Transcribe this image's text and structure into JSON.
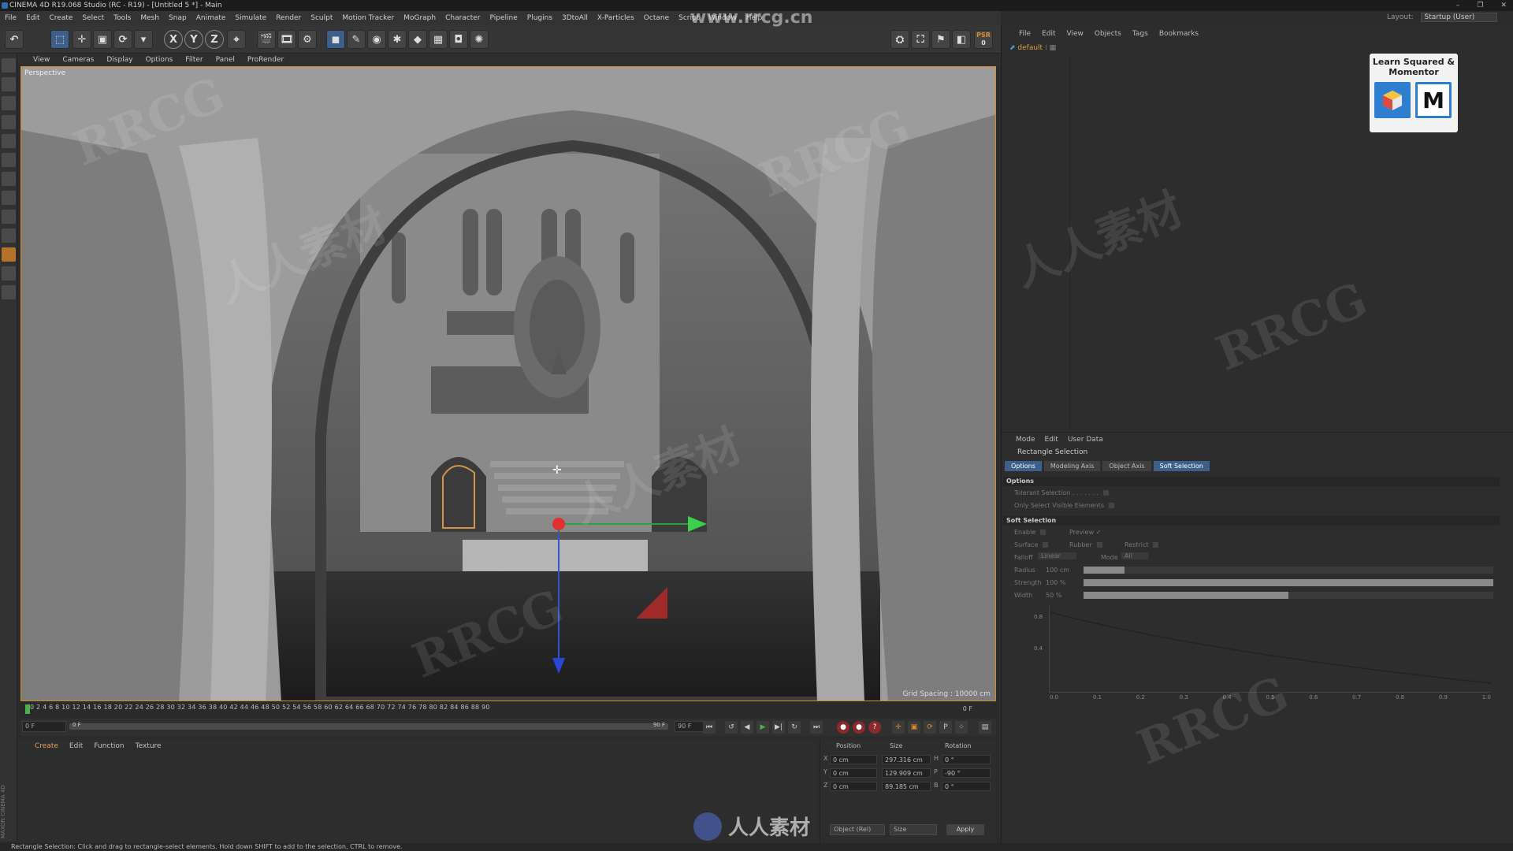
{
  "window": {
    "title": "CINEMA 4D R19.068 Studio (RC - R19) - [Untitled 5 *] - Main",
    "controls": [
      "–",
      "❐",
      "✕"
    ]
  },
  "menubar": [
    "File",
    "Edit",
    "Create",
    "Select",
    "Tools",
    "Mesh",
    "Snap",
    "Animate",
    "Simulate",
    "Render",
    "Sculpt",
    "Motion Tracker",
    "MoGraph",
    "Character",
    "Pipeline",
    "Plugins",
    "3DtoAll",
    "X-Particles",
    "Octane",
    "Script",
    "Window",
    "Help"
  ],
  "layout": {
    "label": "Layout:",
    "value": "Startup (User)"
  },
  "toolbar": {
    "axis_x": "X",
    "axis_y": "Y",
    "axis_z": "Z",
    "psr_label": "PSR",
    "psr_value": "0"
  },
  "viewport": {
    "menu": [
      "View",
      "Cameras",
      "Display",
      "Options",
      "Filter",
      "Panel",
      "ProRender"
    ],
    "camera_label": "Perspective",
    "grid_spacing": "Grid Spacing : 10000 cm"
  },
  "timeline": {
    "ticks": "0   2   4   6   8   10   12   14   16   18   20   22   24   26   28   30   32   34   36   38   40   42   44   46   48   50   52   54   56   58   60   62   64   66   68   70   72   74   76   78   80   82   84   86   88   90",
    "end_frame": "0 F"
  },
  "transport": {
    "start_field": "0 F",
    "current_field": "0 F",
    "max_field": "90 F",
    "end_field": "90 F"
  },
  "materials": {
    "menu": [
      "Create",
      "Edit",
      "Function",
      "Texture"
    ]
  },
  "coords": {
    "header_position": "Position",
    "header_size": "Size",
    "header_rotation": "Rotation",
    "rows": [
      {
        "axis": "X",
        "pos": "0 cm",
        "size": "297.316 cm",
        "rot_axis": "H",
        "rot": "0 °"
      },
      {
        "axis": "Y",
        "pos": "0 cm",
        "size": "129.909 cm",
        "rot_axis": "P",
        "rot": "-90 °"
      },
      {
        "axis": "Z",
        "pos": "0 cm",
        "size": "89.185 cm",
        "rot_axis": "B",
        "rot": "0 °"
      }
    ],
    "mode_dropdown": "Object (Rel)",
    "size_dropdown": "Size",
    "apply": "Apply"
  },
  "objects_panel": {
    "menu": [
      "File",
      "Edit",
      "View",
      "Objects",
      "Tags",
      "Bookmarks"
    ],
    "first_object": "default"
  },
  "attributes": {
    "menu": [
      "Mode",
      "Edit",
      "User Data"
    ],
    "title": "Rectangle Selection",
    "tabs": [
      "Options",
      "Modeling Axis",
      "Object Axis",
      "Soft Selection"
    ],
    "options_header": "Options",
    "tolerant_selection": "Tolerant Selection . . . . . . .",
    "only_visible": "Only Select Visible Elements",
    "soft_header": "Soft Selection",
    "enable": "Enable",
    "preview": "Preview",
    "surface": "Surface",
    "rubber": "Rubber",
    "restrict": "Restrict",
    "falloff": "Falloff",
    "falloff_value": "Linear",
    "mode": "Mode",
    "mode_value": "All",
    "radius": "Radius",
    "radius_value": "100 cm",
    "strength": "Strength",
    "strength_value": "100 %",
    "width": "Width",
    "width_value": "50 %",
    "graph_y": [
      "0.8",
      "0.4"
    ],
    "graph_x": [
      "0.0",
      "0.1",
      "0.2",
      "0.3",
      "0.4",
      "0.5",
      "0.6",
      "0.7",
      "0.8",
      "0.9",
      "1.0"
    ]
  },
  "promo": {
    "title": "Learn Squared & Momentor",
    "logo_letter": "M"
  },
  "status": "Rectangle Selection: Click and drag to rectangle-select elements. Hold down SHIFT to add to the selection, CTRL to remove.",
  "side_brand": "MAXON CINEMA 4D",
  "watermarks": {
    "site": "www.rrcg.cn",
    "brand": "RRCG",
    "cn": "人人素材"
  }
}
